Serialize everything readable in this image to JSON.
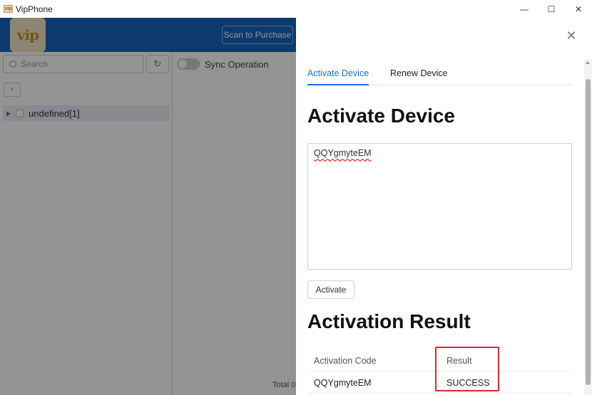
{
  "window": {
    "title": "VipPhone",
    "icon_text": "vip",
    "controls": {
      "minimize": "—",
      "maximize": "☐",
      "close": "✕"
    }
  },
  "header": {
    "logo_text": "vip",
    "scan_button": "Scan to Purchase"
  },
  "left_panel": {
    "search_placeholder": "Search",
    "refresh_icon": "↻",
    "up_button": "↑",
    "tree": [
      {
        "label": "undefined[1]"
      }
    ]
  },
  "main": {
    "sync_label": "Sync Operation",
    "total_text": "Total 0"
  },
  "drawer": {
    "close_icon": "✕",
    "tabs": [
      {
        "label": "Activate Device",
        "active": true
      },
      {
        "label": "Renew Device",
        "active": false
      }
    ],
    "activate_heading": "Activate Device",
    "code_value": "QQYgmyteEM",
    "activate_button": "Activate",
    "result_heading": "Activation Result",
    "table": {
      "columns": [
        "Activation Code",
        "Result"
      ],
      "rows": [
        [
          "QQYgmyteEM",
          "SUCCESS"
        ]
      ]
    },
    "highlight_color": "#e0262b"
  },
  "colors": {
    "header_blue": "#1565c0",
    "tab_active": "#1a73e8"
  }
}
